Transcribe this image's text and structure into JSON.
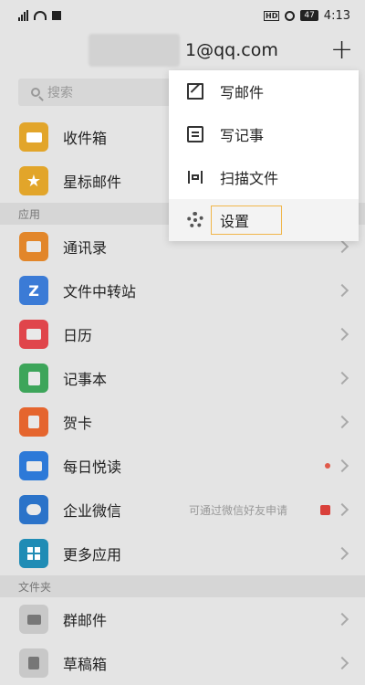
{
  "status_bar": {
    "battery": "47",
    "time": "4:13",
    "hd": "HD"
  },
  "header": {
    "account_email": "1@qq.com",
    "add_symbol": "+"
  },
  "search": {
    "placeholder": "搜索"
  },
  "mailbox": [
    {
      "label": "收件箱",
      "icon": "inbox-icon",
      "color": "#e2a52a"
    },
    {
      "label": "星标邮件",
      "icon": "star-icon",
      "color": "#e2a52a"
    }
  ],
  "sections": {
    "apps": "应用",
    "folders": "文件夹"
  },
  "apps": [
    {
      "label": "通讯录",
      "icon": "contacts-icon",
      "color": "#e2862a"
    },
    {
      "label": "文件中转站",
      "icon": "transfer-icon",
      "color": "#3b7bd6"
    },
    {
      "label": "日历",
      "icon": "calendar-icon",
      "color": "#e0454b"
    },
    {
      "label": "记事本",
      "icon": "notepad-icon",
      "color": "#3da55a"
    },
    {
      "label": "贺卡",
      "icon": "card-icon",
      "color": "#e5652e"
    },
    {
      "label": "每日悦读",
      "icon": "reading-icon",
      "color": "#2c79d8"
    },
    {
      "label": "企业微信",
      "icon": "wework-icon",
      "color": "#2b73c9",
      "hint": "可通过微信好友申请"
    },
    {
      "label": "更多应用",
      "icon": "more-apps-icon",
      "color": "#1f8cb5"
    }
  ],
  "folders": [
    {
      "label": "群邮件",
      "icon": "group-mail-icon",
      "color": "#c8c8c8"
    },
    {
      "label": "草稿箱",
      "icon": "drafts-icon",
      "color": "#c8c8c8"
    }
  ],
  "popup_menu": [
    {
      "label": "写邮件",
      "icon": "compose-icon"
    },
    {
      "label": "写记事",
      "icon": "note-icon"
    },
    {
      "label": "扫描文件",
      "icon": "scan-icon"
    },
    {
      "label": "设置",
      "icon": "settings-gear-icon"
    }
  ]
}
